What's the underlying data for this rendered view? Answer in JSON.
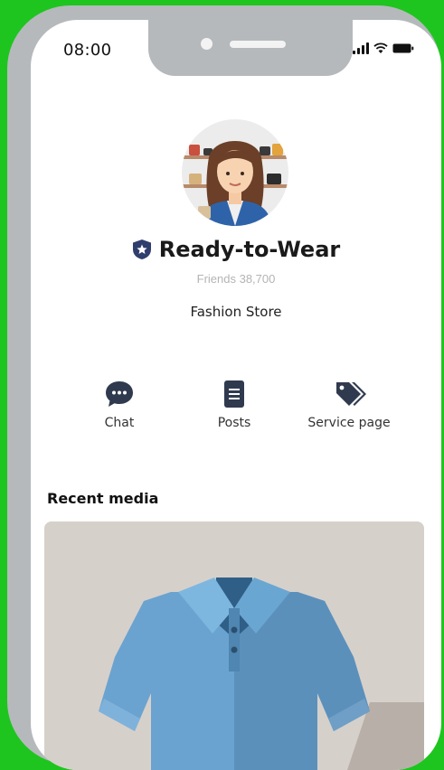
{
  "status_bar": {
    "time": "08:00"
  },
  "profile": {
    "name": "Ready-to-Wear",
    "friends": "Friends 38,700",
    "category": "Fashion Store"
  },
  "actions": [
    {
      "label": "Chat",
      "icon": "chat-bubble-icon"
    },
    {
      "label": "Posts",
      "icon": "document-icon"
    },
    {
      "label": "Service page",
      "icon": "price-tag-icon"
    }
  ],
  "recent_media": {
    "title": "Recent media"
  },
  "colors": {
    "background": "#1ec51e",
    "phone_frame": "#b5b9bc",
    "badge": "#2f3e6d",
    "shirt": "#5b99c6"
  }
}
